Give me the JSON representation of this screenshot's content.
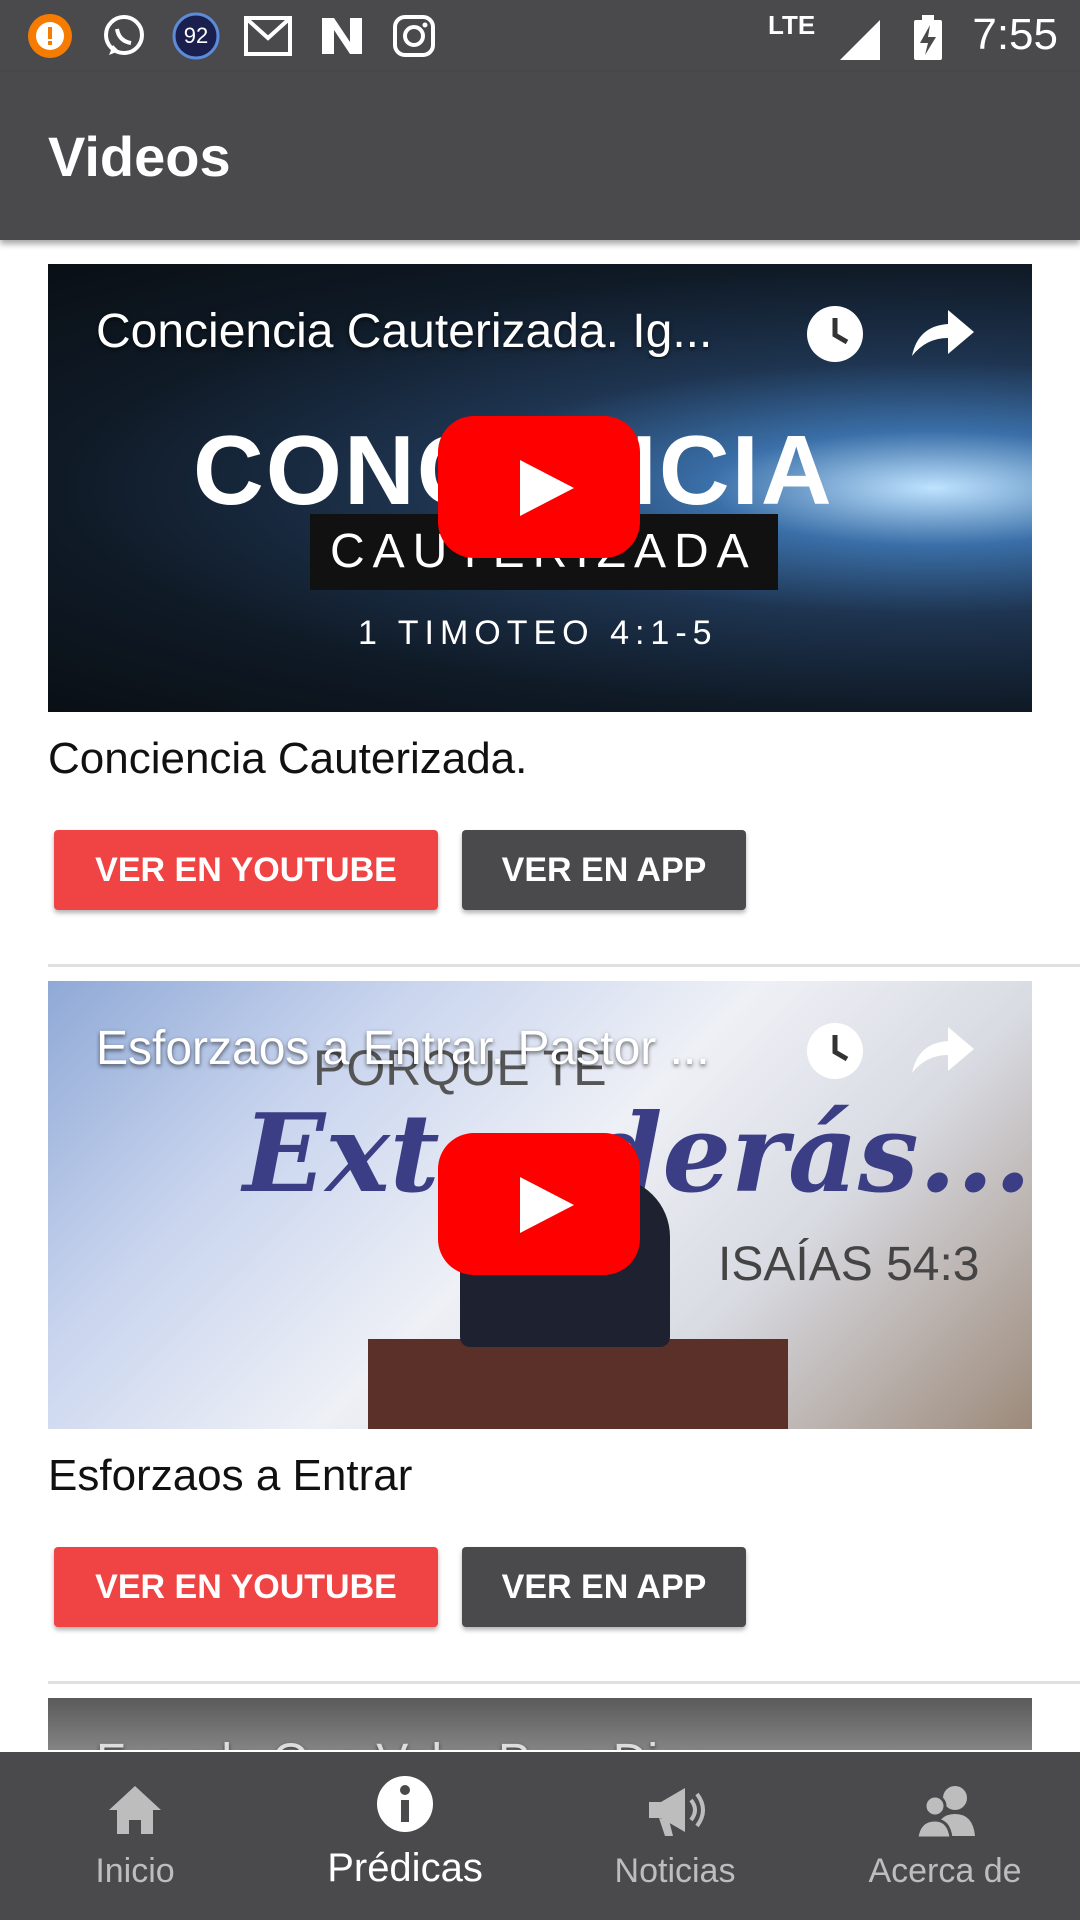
{
  "status_bar": {
    "battery_circle_value": "92",
    "network": "LTE",
    "time": "7:55"
  },
  "app_bar": {
    "title": "Videos"
  },
  "videos": [
    {
      "overlay_title": "Conciencia Cauterizada. Ig...",
      "title": "Conciencia Cauterizada.",
      "youtube_button": "VER EN YOUTUBE",
      "app_button": "VER EN APP",
      "thumb_text": [
        "CONCIENCIA",
        "CAUTERIZADA",
        "1 TIMOTEO 4:1-5"
      ]
    },
    {
      "overlay_title": "Esforzaos a Entrar. Pastor ...",
      "title": "Esforzaos a Entrar",
      "youtube_button": "VER EN YOUTUBE",
      "app_button": "VER EN APP",
      "thumb_text": [
        "PORQUE TE",
        "Extenderás...",
        "ISAÍAS 54:3"
      ]
    },
    {
      "overlay_title": "Fuenda Que Valor Para Dios"
    }
  ],
  "bottom_nav": [
    {
      "label": "Inicio",
      "icon": "home-icon",
      "active": false
    },
    {
      "label": "Prédicas",
      "icon": "info-icon",
      "active": true
    },
    {
      "label": "Noticias",
      "icon": "megaphone-icon",
      "active": false
    },
    {
      "label": "Acerca de",
      "icon": "people-icon",
      "active": false
    }
  ],
  "colors": {
    "bar": "#4a494b",
    "youtube_button": "#f04343",
    "play_red": "#ff0000"
  }
}
